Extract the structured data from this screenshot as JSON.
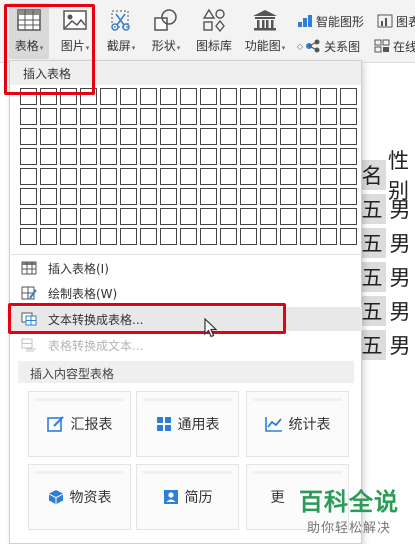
{
  "ribbon": {
    "table_label": "表格",
    "picture_label": "图片",
    "screenshot_label": "截屏",
    "shapes_label": "形状",
    "icon_library_label": "图标库",
    "function_chart_label": "功能图",
    "smart_graphic_label": "智能图形",
    "chart_label_partial": "图表",
    "relation_chart_label": "关系图",
    "online_label_partial": "在线"
  },
  "document": {
    "header_cells": [
      "名",
      "性别"
    ],
    "rows": [
      [
        "五",
        "男"
      ],
      [
        "五",
        "男"
      ],
      [
        "五",
        "男"
      ],
      [
        "五",
        "男"
      ],
      [
        "五",
        "男"
      ]
    ]
  },
  "menu": {
    "insert_table_header": "插入表格",
    "grid_columns": 17,
    "grid_rows": 8,
    "items": [
      {
        "label": "插入表格(I)"
      },
      {
        "label": "绘制表格(W)"
      },
      {
        "label": "文本转换成表格..."
      },
      {
        "label": "表格转换成文本..."
      }
    ],
    "content_tables_title": "插入内容型表格",
    "templates": [
      {
        "label": "汇报表",
        "icon": "report-edit-icon"
      },
      {
        "label": "通用表",
        "icon": "grid-icon"
      },
      {
        "label": "统计表",
        "icon": "line-chart-icon"
      },
      {
        "label": "物资表",
        "icon": "box-icon"
      },
      {
        "label": "简历",
        "icon": "person-card-icon"
      },
      {
        "label": "更",
        "icon": ""
      }
    ]
  },
  "watermark": {
    "title": "百科全说",
    "subtitle": "助你轻松解决"
  },
  "colors": {
    "highlight": "#e60012",
    "watermark": "#2a9c57",
    "accent_blue": "#2f7fd8"
  }
}
